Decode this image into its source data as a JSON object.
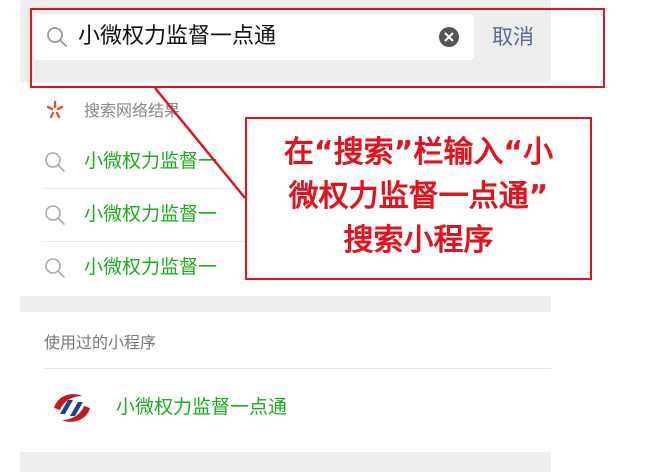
{
  "search": {
    "query": "小微权力监督一点通",
    "cancel_label": "取消"
  },
  "web_results": {
    "section_label": "搜索网络结果",
    "items": [
      {
        "label": "小微权力监督一"
      },
      {
        "label": "小微权力监督一"
      },
      {
        "label": "小微权力监督一"
      }
    ]
  },
  "used_mini_programs": {
    "section_label": "使用过的小程序",
    "items": [
      {
        "name": "小微权力监督一点通"
      }
    ]
  },
  "annotation": {
    "lines": [
      "在“搜索”栏输入“小",
      "微权力监督一点通”",
      "搜索小程序"
    ]
  },
  "colors": {
    "accent_green": "#1aad19",
    "link_blue": "#576b95",
    "annotation_red": "#e0141e",
    "bar_gray": "#ededed"
  }
}
